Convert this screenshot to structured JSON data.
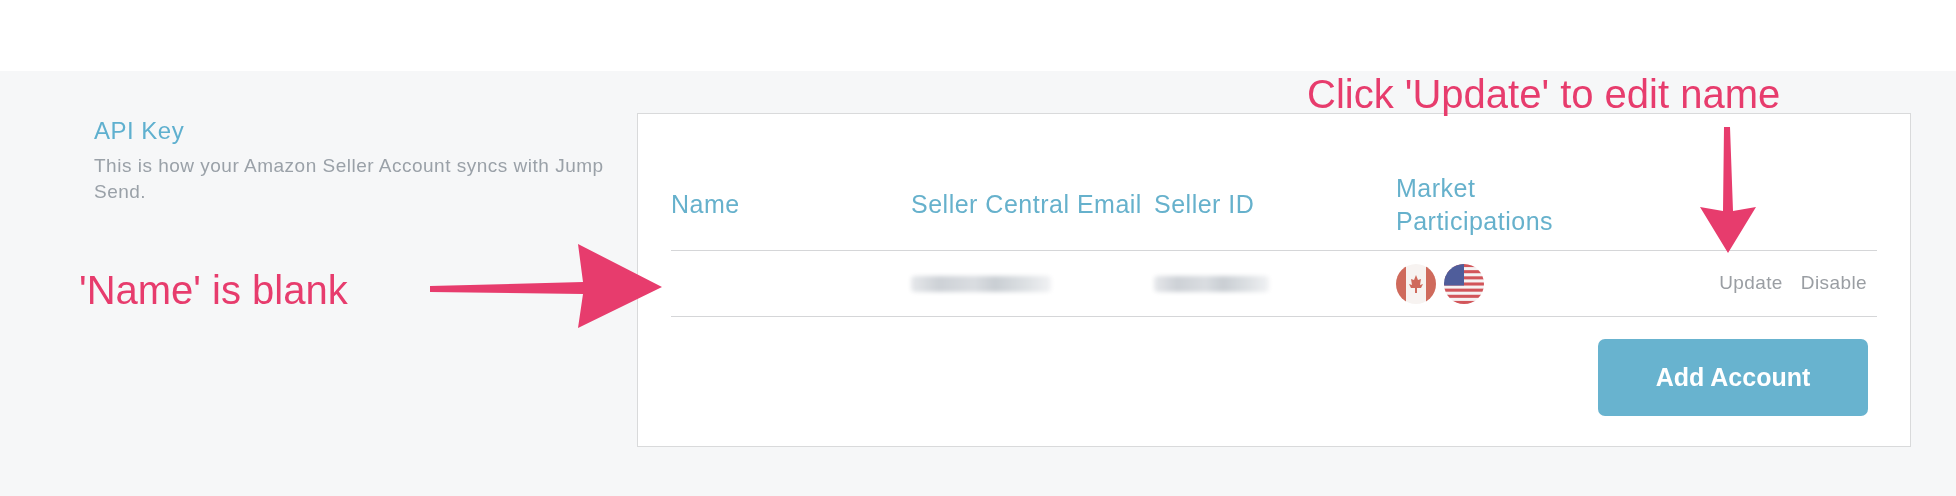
{
  "section": {
    "title": "API Key",
    "description": "This is how your Amazon Seller Account syncs with Jump Send."
  },
  "table": {
    "columns": [
      "Name",
      "Seller Central Email",
      "Seller ID",
      "Market Participations"
    ],
    "rows": [
      {
        "markets": [
          {
            "kind": "canada"
          },
          {
            "kind": "usa"
          }
        ],
        "actions": [
          "Update",
          "Disable"
        ]
      }
    ]
  },
  "add_button": "Add Account",
  "annotations": [
    {
      "text": "'Name' is blank",
      "kind": "arrow-right"
    },
    {
      "text": "Click 'Update' to edit name",
      "kind": "arrow-down"
    }
  ]
}
